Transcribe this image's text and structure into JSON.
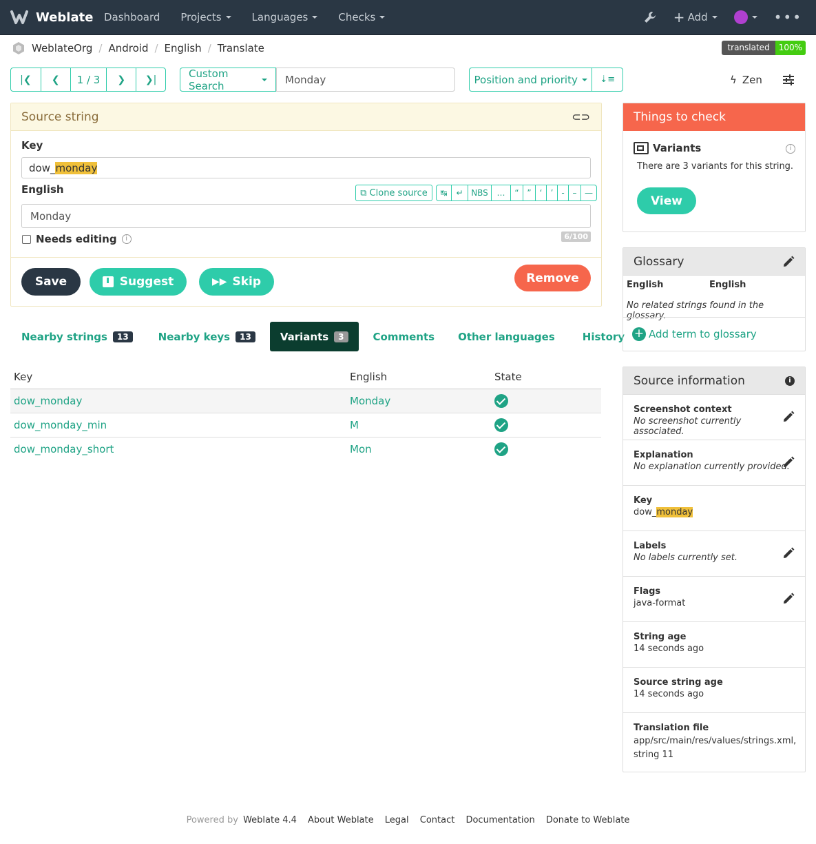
{
  "nav": {
    "brand": "Weblate",
    "links": [
      "Dashboard",
      "Projects",
      "Languages",
      "Checks"
    ],
    "add": "Add",
    "icons": {
      "tools": "wrench-icon",
      "add": "plus-icon",
      "user": "avatar-icon",
      "more": "dots-icon"
    }
  },
  "breadcrumb": {
    "items": [
      "WeblateOrg",
      "Android",
      "English",
      "Translate"
    ]
  },
  "badge": {
    "label": "translated",
    "value": "100%"
  },
  "pager": {
    "position": "1 / 3"
  },
  "search": {
    "mode": "Custom Search",
    "query": "Monday"
  },
  "sort": {
    "label": "Position and priority"
  },
  "zen": {
    "label": "Zen"
  },
  "source": {
    "title": "Source string",
    "key_label": "Key",
    "key_prefix": "dow_",
    "key_highlight": "monday",
    "lang_label": "English",
    "clone": "Clone source",
    "specials": [
      "↹",
      "↵",
      "NBS",
      "…",
      "“",
      "”",
      "‘",
      "’",
      "-",
      "–",
      "—"
    ],
    "value": "Monday",
    "needs_editing": "Needs editing",
    "counter": "6/100",
    "save": "Save",
    "suggest": "Suggest",
    "skip": "Skip",
    "remove": "Remove"
  },
  "tabs": [
    {
      "label": "Nearby strings",
      "count": "13"
    },
    {
      "label": "Nearby keys",
      "count": "13"
    },
    {
      "label": "Variants",
      "count": "3"
    },
    {
      "label": "Comments"
    },
    {
      "label": "Other languages"
    },
    {
      "label": "History"
    }
  ],
  "variants": {
    "headers": [
      "Key",
      "English",
      "State"
    ],
    "rows": [
      {
        "key": "dow_monday",
        "english": "Monday"
      },
      {
        "key": "dow_monday_min",
        "english": "M"
      },
      {
        "key": "dow_monday_short",
        "english": "Mon"
      }
    ]
  },
  "checks": {
    "title": "Things to check",
    "name": "Variants",
    "desc": "There are 3 variants for this string.",
    "view": "View"
  },
  "glossary": {
    "title": "Glossary",
    "col1": "English",
    "col2": "English",
    "empty": "No related strings found in the glossary.",
    "add": "Add term to glossary"
  },
  "info": {
    "title": "Source information",
    "items": [
      {
        "title": "Screenshot context",
        "value": "No screenshot currently associated."
      },
      {
        "title": "Explanation",
        "value": "No explanation currently provided."
      },
      {
        "title": "Key",
        "prefix": "dow_",
        "highlight": "monday"
      },
      {
        "title": "Labels",
        "value": "No labels currently set."
      },
      {
        "title": "Flags",
        "value": "java-format"
      },
      {
        "title": "String age",
        "value": "14 seconds ago"
      },
      {
        "title": "Source string age",
        "value": "14 seconds ago"
      },
      {
        "title": "Translation file",
        "value": "app/src/main/res/values/strings.xml, string 11"
      }
    ]
  },
  "footer": {
    "powered": "Powered by",
    "version": "Weblate 4.4",
    "links": [
      "About Weblate",
      "Legal",
      "Contact",
      "Documentation",
      "Donate to Weblate"
    ]
  }
}
